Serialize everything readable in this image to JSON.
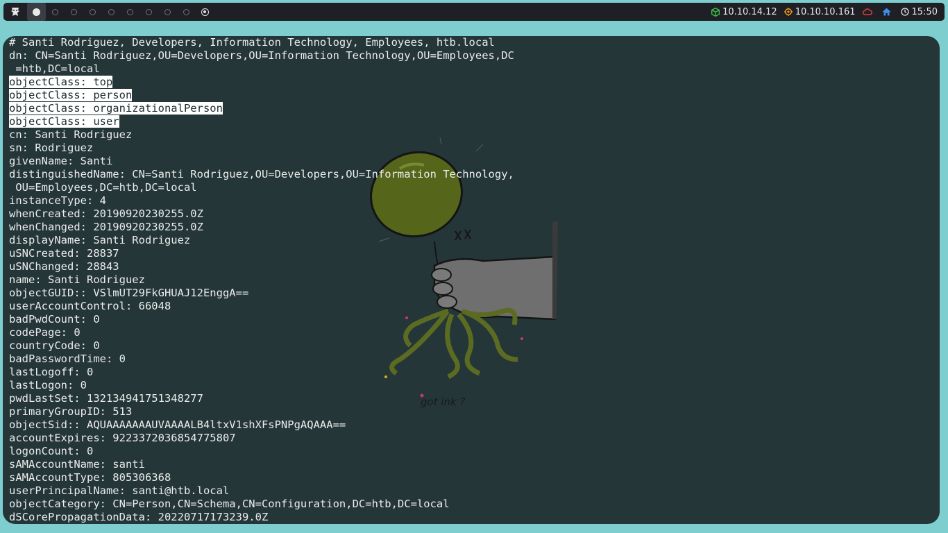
{
  "topbar": {
    "workspaces": [
      "1",
      "2",
      "3",
      "4",
      "5",
      "6",
      "7",
      "8",
      "9",
      "10"
    ],
    "active_workspace": 0,
    "vpn_ip": "10.10.14.12",
    "target_ip": "10.10.10.161",
    "clock": "15:50",
    "colors": {
      "vpn": "#3fc14a",
      "target": "#f39a1c",
      "cloud": "#e03c3c",
      "home": "#3b8de6"
    }
  },
  "terminal": {
    "lines": [
      {
        "text": "# Santi Rodriguez, Developers, Information Technology, Employees, htb.local",
        "highlight": false
      },
      {
        "text": "dn: CN=Santi Rodriguez,OU=Developers,OU=Information Technology,OU=Employees,DC",
        "highlight": false
      },
      {
        "text": " =htb,DC=local",
        "highlight": false
      },
      {
        "text": "objectClass: top",
        "highlight": true
      },
      {
        "text": "objectClass: person",
        "highlight": true
      },
      {
        "text": "objectClass: organizationalPerson",
        "highlight": true
      },
      {
        "text": "objectClass: user",
        "highlight": true
      },
      {
        "text": "cn: Santi Rodriguez",
        "highlight": false
      },
      {
        "text": "sn: Rodriguez",
        "highlight": false
      },
      {
        "text": "givenName: Santi",
        "highlight": false
      },
      {
        "text": "distinguishedName: CN=Santi Rodriguez,OU=Developers,OU=Information Technology,",
        "highlight": false
      },
      {
        "text": " OU=Employees,DC=htb,DC=local",
        "highlight": false
      },
      {
        "text": "instanceType: 4",
        "highlight": false
      },
      {
        "text": "whenCreated: 20190920230255.0Z",
        "highlight": false
      },
      {
        "text": "whenChanged: 20190920230255.0Z",
        "highlight": false
      },
      {
        "text": "displayName: Santi Rodriguez",
        "highlight": false
      },
      {
        "text": "uSNCreated: 28837",
        "highlight": false
      },
      {
        "text": "uSNChanged: 28843",
        "highlight": false
      },
      {
        "text": "name: Santi Rodriguez",
        "highlight": false
      },
      {
        "text": "objectGUID:: VSlmUT29FkGHUAJ12EnggA==",
        "highlight": false
      },
      {
        "text": "userAccountControl: 66048",
        "highlight": false
      },
      {
        "text": "badPwdCount: 0",
        "highlight": false
      },
      {
        "text": "codePage: 0",
        "highlight": false
      },
      {
        "text": "countryCode: 0",
        "highlight": false
      },
      {
        "text": "badPasswordTime: 0",
        "highlight": false
      },
      {
        "text": "lastLogoff: 0",
        "highlight": false
      },
      {
        "text": "lastLogon: 0",
        "highlight": false
      },
      {
        "text": "pwdLastSet: 132134941751348277",
        "highlight": false
      },
      {
        "text": "primaryGroupID: 513",
        "highlight": false
      },
      {
        "text": "objectSid:: AQUAAAAAAAUVAAAALB4ltxV1shXFsPNPgAQAAA==",
        "highlight": false
      },
      {
        "text": "accountExpires: 9223372036854775807",
        "highlight": false
      },
      {
        "text": "logonCount: 0",
        "highlight": false
      },
      {
        "text": "sAMAccountName: santi",
        "highlight": false
      },
      {
        "text": "sAMAccountType: 805306368",
        "highlight": false
      },
      {
        "text": "userPrincipalName: santi@htb.local",
        "highlight": false
      },
      {
        "text": "objectCategory: CN=Person,CN=Schema,CN=Configuration,DC=htb,DC=local",
        "highlight": false
      },
      {
        "text": "dSCorePropagationData: 20220717173239.0Z",
        "highlight": false
      }
    ]
  },
  "wallpaper": {
    "caption": "got ink ?",
    "colors": {
      "balloon": "#5a6b1c",
      "hand": "#6d6d6d",
      "tentacles": "#5c6b22"
    }
  }
}
